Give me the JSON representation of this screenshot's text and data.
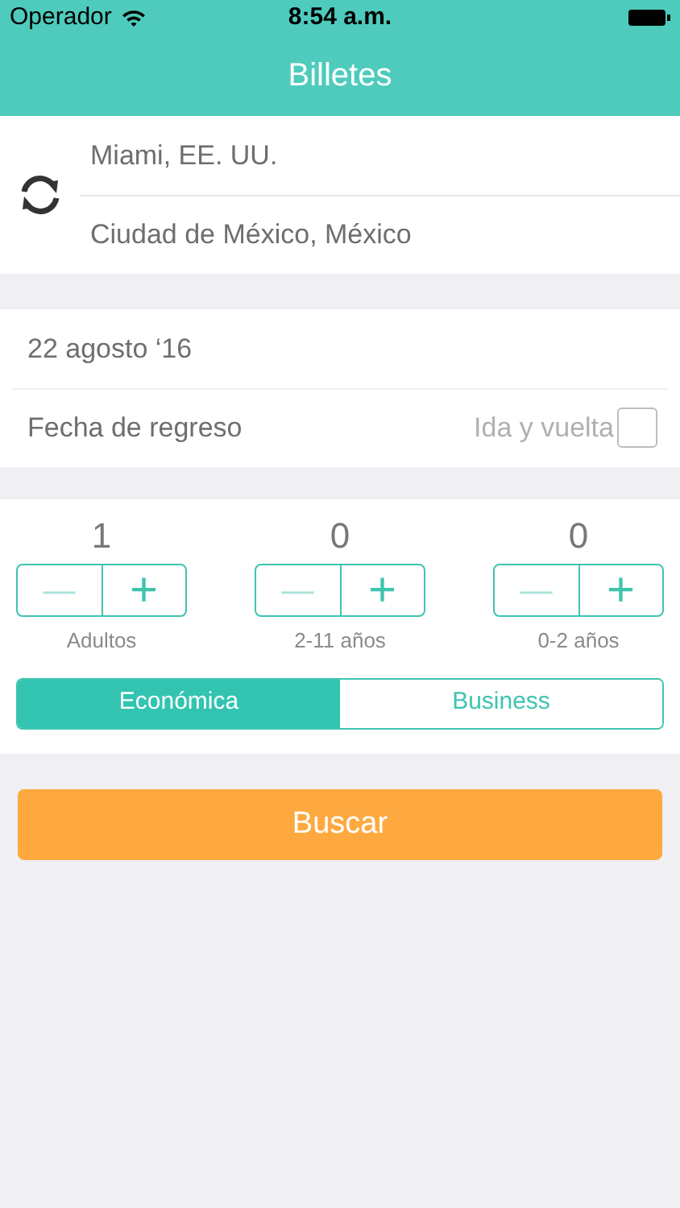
{
  "status_bar": {
    "carrier": "Operador",
    "time": "8:54 a.m."
  },
  "nav": {
    "title": "Billetes"
  },
  "route": {
    "origin": "Miami, EE. UU.",
    "destination": "Ciudad de México, México"
  },
  "dates": {
    "departure": "22 agosto ‘16",
    "return_label": "Fecha de regreso",
    "round_trip_label": "Ida y vuelta",
    "round_trip_checked": false
  },
  "passengers": [
    {
      "count": "1",
      "label": "Adultos",
      "minus": "—",
      "plus": "+"
    },
    {
      "count": "0",
      "label": "2-11 años",
      "minus": "—",
      "plus": "+"
    },
    {
      "count": "0",
      "label": "0-2 años",
      "minus": "—",
      "plus": "+"
    }
  ],
  "cabin_classes": [
    {
      "label": "Económica",
      "selected": true
    },
    {
      "label": "Business",
      "selected": false
    }
  ],
  "search_button": "Buscar"
}
